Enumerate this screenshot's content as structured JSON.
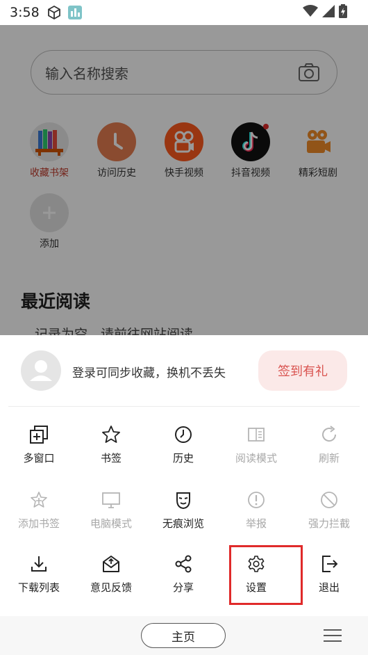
{
  "status_bar": {
    "time": "3:58"
  },
  "search": {
    "placeholder": "输入名称搜索"
  },
  "quick_links": [
    {
      "label": "收藏书架",
      "icon": "bookshelf-icon"
    },
    {
      "label": "访问历史",
      "icon": "clock-icon"
    },
    {
      "label": "快手视频",
      "icon": "kuaishou-icon"
    },
    {
      "label": "抖音视频",
      "icon": "douyin-icon"
    },
    {
      "label": "精彩短剧",
      "icon": "video-camera-icon"
    },
    {
      "label": "添加",
      "icon": "plus-icon"
    }
  ],
  "recent": {
    "title": "最近阅读",
    "empty_text": "记录为空，请前往网站阅读"
  },
  "sheet": {
    "login_text": "登录可同步收藏，换机不丢失",
    "checkin_label": "签到有礼",
    "menu": [
      {
        "label": "多窗口",
        "icon": "multi-window-icon",
        "enabled": true
      },
      {
        "label": "书签",
        "icon": "star-icon",
        "enabled": true
      },
      {
        "label": "历史",
        "icon": "history-icon",
        "enabled": true
      },
      {
        "label": "阅读模式",
        "icon": "reader-icon",
        "enabled": false
      },
      {
        "label": "刷新",
        "icon": "refresh-icon",
        "enabled": false
      },
      {
        "label": "添加书签",
        "icon": "add-bookmark-icon",
        "enabled": false
      },
      {
        "label": "电脑模式",
        "icon": "desktop-icon",
        "enabled": false
      },
      {
        "label": "无痕浏览",
        "icon": "incognito-mask-icon",
        "enabled": true
      },
      {
        "label": "举报",
        "icon": "report-icon",
        "enabled": false
      },
      {
        "label": "强力拦截",
        "icon": "block-icon",
        "enabled": false
      },
      {
        "label": "下载列表",
        "icon": "download-icon",
        "enabled": true
      },
      {
        "label": "意见反馈",
        "icon": "feedback-icon",
        "enabled": true
      },
      {
        "label": "分享",
        "icon": "share-icon",
        "enabled": true
      },
      {
        "label": "设置",
        "icon": "settings-gear-icon",
        "enabled": true
      },
      {
        "label": "退出",
        "icon": "exit-icon",
        "enabled": true
      }
    ]
  },
  "bottom_bar": {
    "home_label": "主页"
  },
  "colors": {
    "accent_red": "#d9534f",
    "highlight_border": "#e02a2a",
    "disabled_text": "#a8a8a8"
  }
}
